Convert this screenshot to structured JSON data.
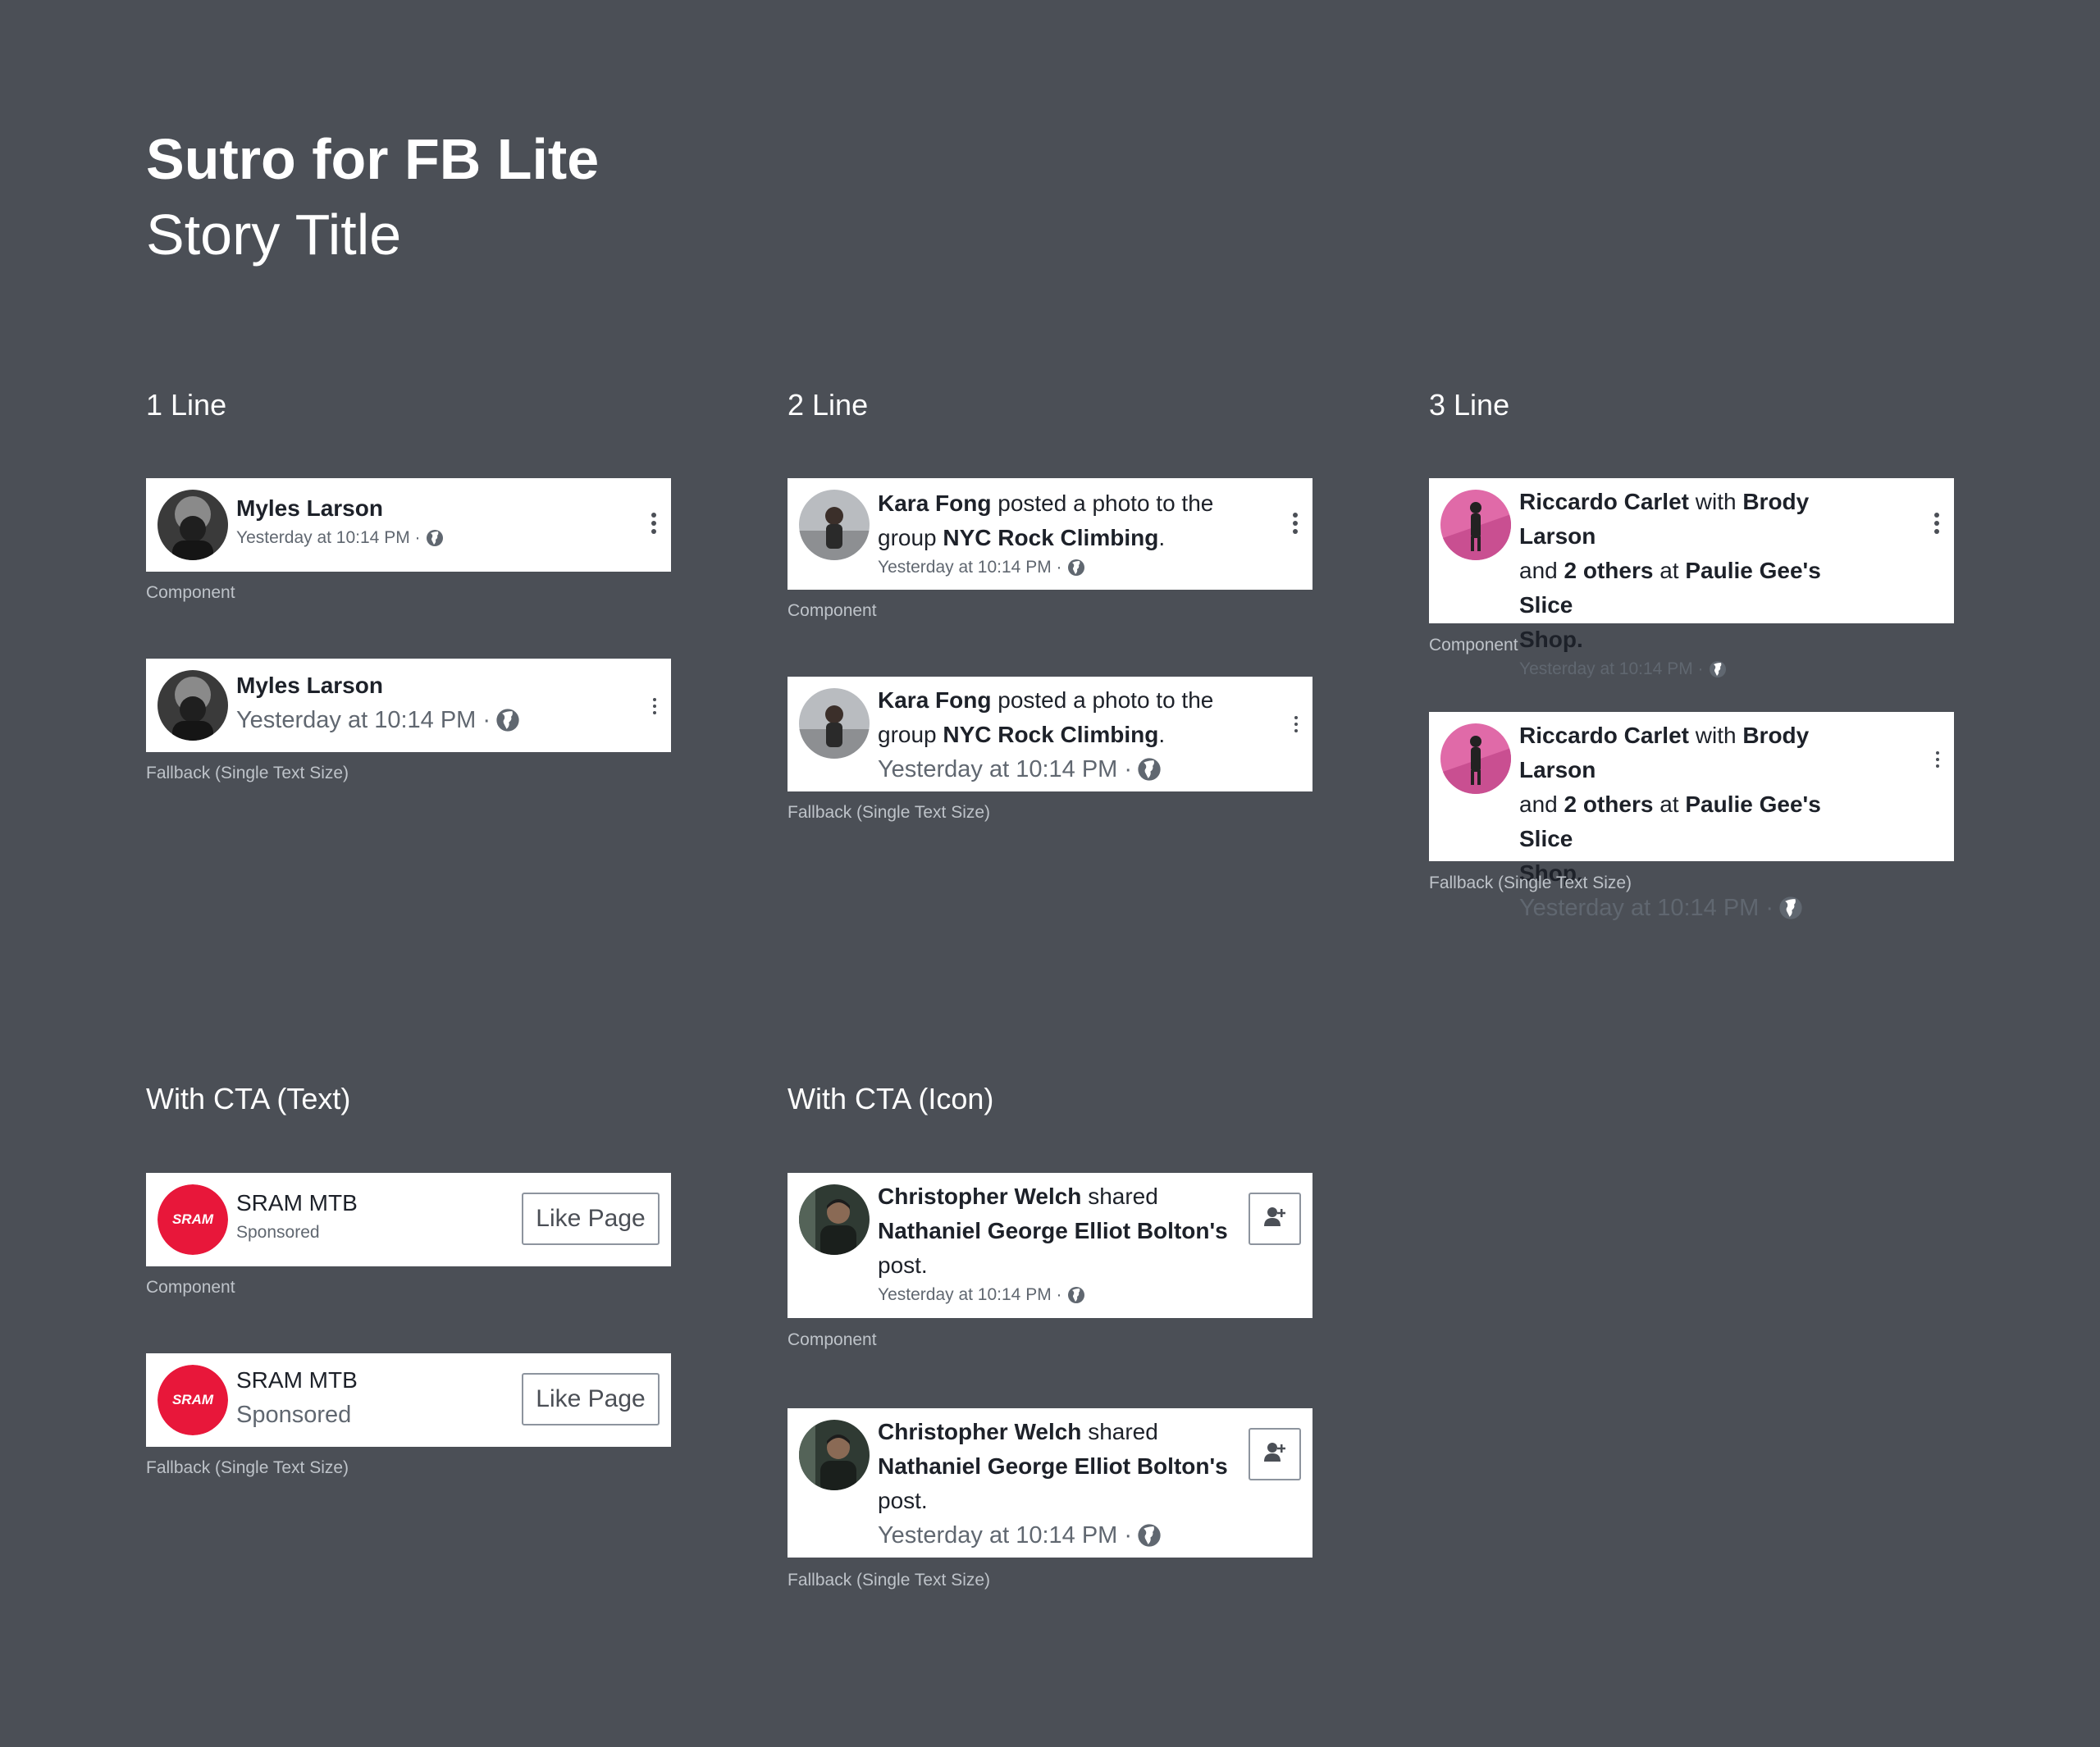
{
  "header": {
    "title": "Sutro for FB Lite",
    "subtitle": "Story Title"
  },
  "sections": {
    "one_line": "1 Line",
    "two_line": "2 Line",
    "three_line": "3 Line",
    "cta_text": "With CTA (Text)",
    "cta_icon": "With CTA (Icon)"
  },
  "captions": {
    "component": "Component",
    "fallback": "Fallback (Single Text Size)"
  },
  "meta": {
    "timestamp": "Yesterday at 10:14 PM",
    "separator": "·",
    "sponsored": "Sponsored"
  },
  "one_line": {
    "name": "Myles Larson"
  },
  "two_line": {
    "name": "Kara Fong",
    "verb": "posted a photo to the",
    "group_prefix": "group",
    "group": "NYC Rock Climbing",
    "period": "."
  },
  "three_line": {
    "name": "Riccardo Carlet",
    "with": "with",
    "friend": "Brody Larson",
    "and": "and",
    "others": "2 others",
    "at": "at",
    "place1": "Paulie Gee's Slice",
    "place2": "Shop."
  },
  "cta_text": {
    "name": "SRAM MTB",
    "button": "Like Page",
    "logo": "SRAM"
  },
  "cta_icon": {
    "name": "Christopher Welch",
    "verb": "shared",
    "target": "Nathaniel George Elliot Bolton's",
    "post": "post.",
    "icon": "add-friend-icon"
  },
  "colors": {
    "background": "#4b4f56",
    "sram_red": "#e8173a",
    "pink_avatar": "#e06aa8"
  }
}
